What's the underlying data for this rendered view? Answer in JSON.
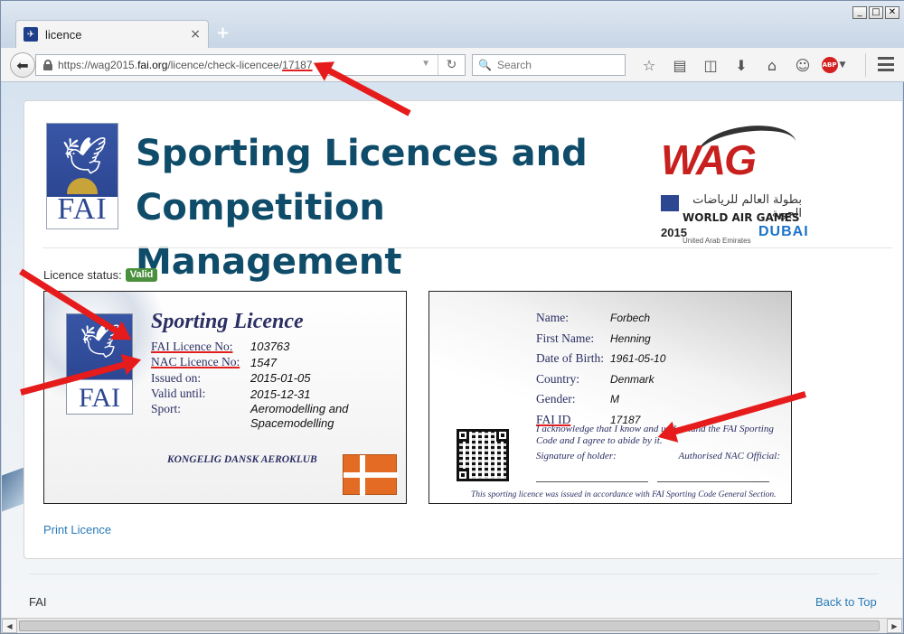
{
  "browser": {
    "window_controls": [
      "_",
      "□",
      "✕"
    ],
    "tab_title": "licence",
    "tab_close": "×",
    "new_tab": "+",
    "url_prefix": "https://wag2015.",
    "url_domain": "fai.org",
    "url_path": "/licence/check-licencee/",
    "url_id": "17187",
    "search_placeholder": "Search",
    "toolbar_icons": [
      "star-icon",
      "reading-list-icon",
      "pocket-icon",
      "download-icon",
      "home-icon",
      "chat-icon",
      "adblock-icon",
      "menu-icon"
    ],
    "abp_label": "ABP"
  },
  "page": {
    "title": "Sporting Licences and Competition Management",
    "fai_logo_text": "FAI",
    "wag": {
      "logo_text": "WAG",
      "arabic": "بطولة العالم للرياضات الجوية",
      "name": "WORLD AIR GAMES",
      "year": "2015",
      "location": "United Arab Emirates",
      "city": "DUBAI"
    },
    "status_label": "Licence status:",
    "status_value": "Valid",
    "print_link": "Print Licence",
    "footer_left": "FAI",
    "footer_right": "Back to Top"
  },
  "licence_front": {
    "title": "Sporting Licence",
    "fields": [
      {
        "label": "FAI Licence No:",
        "value": "103763"
      },
      {
        "label": "NAC Licence No:",
        "value": "1547"
      },
      {
        "label": "Issued on:",
        "value": "2015-01-05"
      },
      {
        "label": "Valid until:",
        "value": "2015-12-31"
      },
      {
        "label": "Sport:",
        "value": "Aeromodelling and Spacemodelling"
      }
    ],
    "club": "KONGELIG DANSK AEROKLUB"
  },
  "licence_back": {
    "fields": [
      {
        "label": "Name:",
        "value": "Forbech"
      },
      {
        "label": "First Name:",
        "value": "Henning"
      },
      {
        "label": "Date of Birth:",
        "value": "1961-05-10"
      },
      {
        "label": "Country:",
        "value": "Denmark"
      },
      {
        "label": "Gender:",
        "value": "M"
      },
      {
        "label": "FAI ID",
        "value": "17187"
      }
    ],
    "acknowledgement": "I acknowledge that I know and understand the FAI Sporting Code and I agree to abide by it.",
    "signature_holder": "Signature of holder:",
    "signature_official": "Authorised NAC Official:",
    "issued_note": "This sporting licence was issued in accordance with FAI Sporting Code General Section."
  },
  "colors": {
    "accent": "#e61b1b",
    "title": "#0f4c6a",
    "link": "#2a7ab8",
    "badge": "#4a8f3d"
  }
}
